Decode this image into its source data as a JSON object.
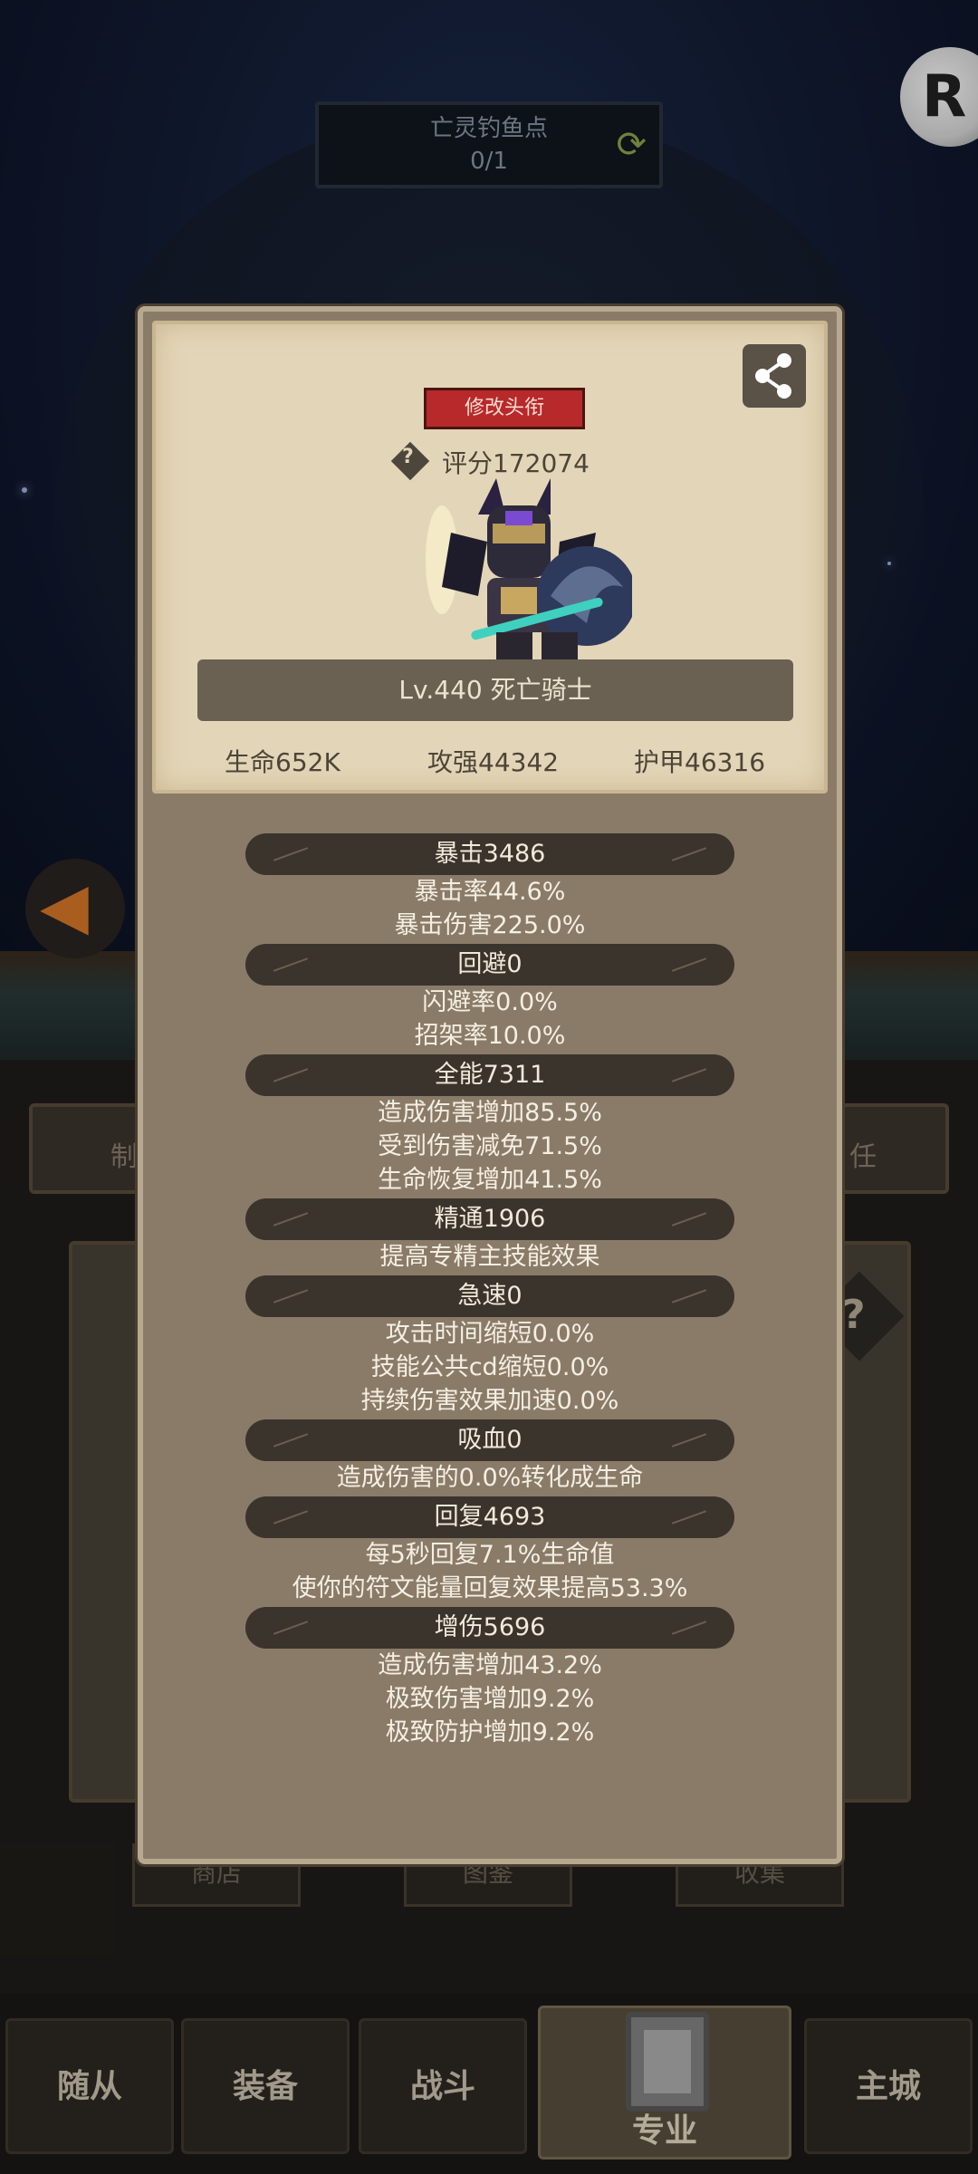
{
  "top": {
    "spot_title": "亡灵钓鱼点",
    "spot_count": "0/1",
    "logo_glyph": "R",
    "refresh_icon": "refresh-icon",
    "back_icon": "arrow-left-icon"
  },
  "background": {
    "left_box_glyph": "制",
    "right_box_glyph": "任",
    "help_glyph": "?",
    "tabs": [
      "商店",
      "图鉴",
      "收集"
    ]
  },
  "popup": {
    "change_title_label": "修改头衔",
    "help_glyph": "?",
    "score": "评分172074",
    "level_class": "Lv.440 死亡骑士",
    "main_stats": [
      "生命652K",
      "攻强44342",
      "护甲46316"
    ],
    "stat_groups": [
      {
        "header": "暴击3486",
        "lines": [
          "暴击率44.6%",
          "暴击伤害225.0%"
        ]
      },
      {
        "header": "回避0",
        "lines": [
          "闪避率0.0%",
          "招架率10.0%"
        ]
      },
      {
        "header": "全能7311",
        "lines": [
          "造成伤害增加85.5%",
          "受到伤害减免71.5%",
          "生命恢复增加41.5%"
        ]
      },
      {
        "header": "精通1906",
        "lines": [
          "提高专精主技能效果"
        ]
      },
      {
        "header": "急速0",
        "lines": [
          "攻击时间缩短0.0%",
          "技能公共cd缩短0.0%",
          "持续伤害效果加速0.0%"
        ]
      },
      {
        "header": "吸血0",
        "lines": [
          "造成伤害的0.0%转化成生命"
        ]
      },
      {
        "header": "回复4693",
        "lines": [
          "每5秒回复7.1%生命值",
          "使你的符文能量回复效果提高53.3%"
        ]
      },
      {
        "header": "增伤5696",
        "lines": [
          "造成伤害增加43.2%",
          "极致伤害增加9.2%",
          "极致防护增加9.2%"
        ]
      }
    ]
  },
  "nav": {
    "items": [
      "随从",
      "装备",
      "战斗",
      "专业",
      "主城"
    ],
    "active_index": 3
  },
  "colors": {
    "popup_bg": "#8a7b68",
    "parchment": "#e3d6b8",
    "title_button": "#b8292b",
    "stat_header_bg": "#3a342c"
  }
}
